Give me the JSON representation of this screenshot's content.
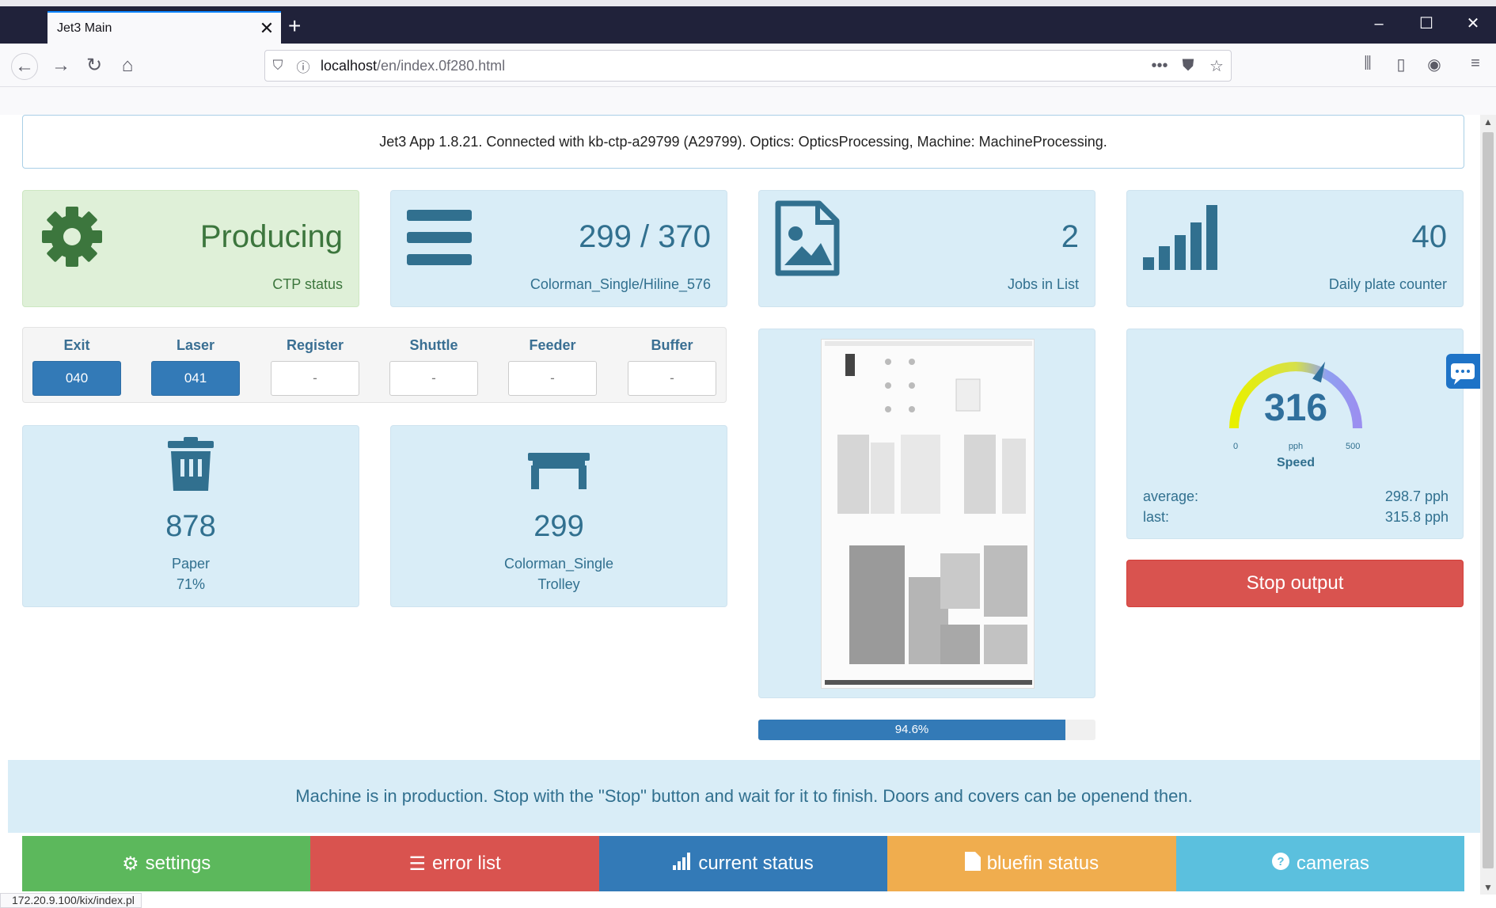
{
  "browser": {
    "tab_title": "Jet3 Main",
    "tab_close": "✕",
    "new_tab": "+",
    "url_host": "localhost",
    "url_path": "/en/index.0f280.html",
    "url_more": "•••",
    "status_url": "172.20.9.100/kix/index.pl"
  },
  "info_bar": "Jet3 App 1.8.21. Connected with kb-ctp-a29799 (A29799). Optics: OpticsProcessing, Machine: MachineProcessing.",
  "stats": {
    "ctp_status": {
      "value": "Producing",
      "label": "CTP status"
    },
    "plates": {
      "value": "299 / 370",
      "label": "Colorman_Single/Hiline_576"
    },
    "jobs": {
      "value": "2",
      "label": "Jobs in List"
    },
    "daily": {
      "value": "40",
      "label": "Daily plate counter"
    }
  },
  "units": [
    {
      "label": "Exit",
      "value": "040",
      "active": true
    },
    {
      "label": "Laser",
      "value": "041",
      "active": true
    },
    {
      "label": "Register",
      "value": "-",
      "active": false
    },
    {
      "label": "Shuttle",
      "value": "-",
      "active": false
    },
    {
      "label": "Feeder",
      "value": "-",
      "active": false
    },
    {
      "label": "Buffer",
      "value": "-",
      "active": false
    }
  ],
  "paper": {
    "count": "878",
    "label": "Paper",
    "percent": "71%"
  },
  "trolley": {
    "count": "299",
    "label": "Colorman_Single",
    "sub": "Trolley"
  },
  "progress": {
    "text": "94.6%",
    "fraction": 0.91
  },
  "speed": {
    "value": "316",
    "min": "0",
    "unit": "pph",
    "max": "500",
    "label": "Speed",
    "average_label": "average:",
    "average_value": "298.7 pph",
    "last_label": "last:",
    "last_value": "315.8 pph",
    "gauge_fraction": 0.632
  },
  "stop_button": "Stop output",
  "alert": "Machine is in production. Stop with the \"Stop\" button and wait for it to finish. Doors and covers can be openend then.",
  "footer": [
    {
      "label": "settings",
      "icon": "gear-icon",
      "color": "#5cb85c"
    },
    {
      "label": "error list",
      "icon": "list-icon",
      "color": "#d9534f"
    },
    {
      "label": "current status",
      "icon": "signal-icon",
      "color": "#337ab7"
    },
    {
      "label": "bluefin status",
      "icon": "file-icon",
      "color": "#f0ad4e"
    },
    {
      "label": "cameras",
      "icon": "question-icon",
      "color": "#5bc0de"
    }
  ],
  "colors": {
    "info_blue": "#d9edf7",
    "success_green": "#dff0d8",
    "primary": "#337ab7",
    "danger": "#d9534f"
  }
}
